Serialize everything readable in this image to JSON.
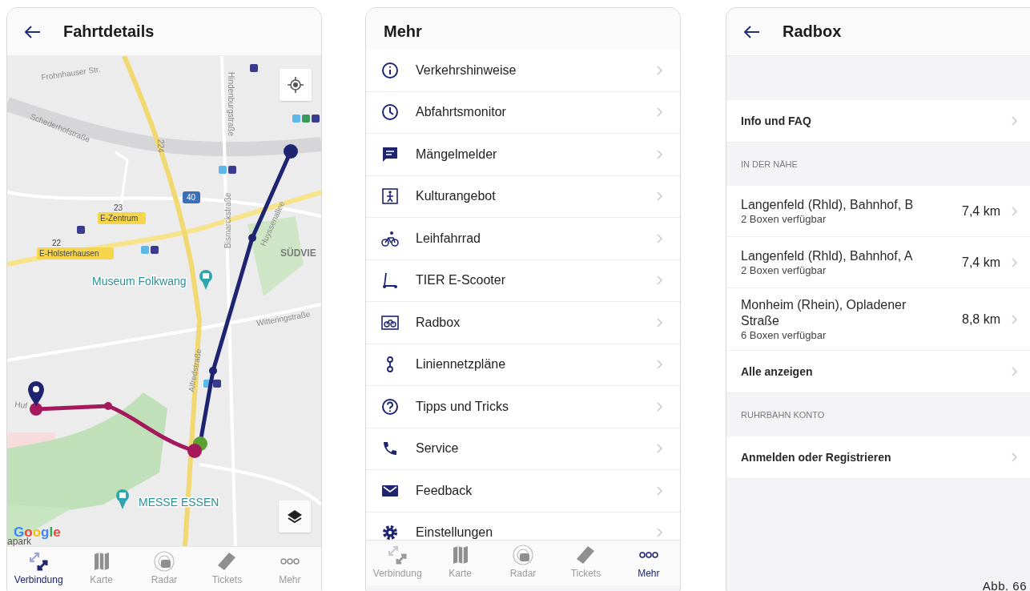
{
  "trip_details": {
    "title": "Fahrtdetails",
    "map": {
      "labels": [
        {
          "text": "Frohnhauser Str.",
          "kind": "street"
        },
        {
          "text": "Schederhofstraße",
          "kind": "street"
        },
        {
          "text": "224",
          "kind": "street"
        },
        {
          "text": "40",
          "kind": "road_number"
        },
        {
          "text": "Hindenburgstraße",
          "kind": "street"
        },
        {
          "text": "Bismarckstraße",
          "kind": "street"
        },
        {
          "text": "Huyssenallee",
          "kind": "street"
        },
        {
          "text": "23",
          "kind": "stop_number"
        },
        {
          "text": "E-Zentrum",
          "kind": "stop_label"
        },
        {
          "text": "22",
          "kind": "stop_number"
        },
        {
          "text": "E-Holsterhausen",
          "kind": "stop_label"
        },
        {
          "text": "SÜDVIE",
          "kind": "district"
        },
        {
          "text": "Museum Folkwang",
          "kind": "poi"
        },
        {
          "text": "Witteringstraße",
          "kind": "street"
        },
        {
          "text": "Alfredstraße",
          "kind": "street"
        },
        {
          "text": "Huf",
          "kind": "street"
        },
        {
          "text": "MESSE ESSEN",
          "kind": "poi"
        },
        {
          "text": "apark",
          "kind": "area"
        },
        {
          "text": "Google",
          "kind": "logo"
        }
      ]
    },
    "tab_bar": [
      {
        "label": "Verbindung",
        "selected": true
      },
      {
        "label": "Karte",
        "selected": false
      },
      {
        "label": "Radar",
        "selected": false
      },
      {
        "label": "Tickets",
        "selected": false
      },
      {
        "label": "Mehr",
        "selected": false
      }
    ]
  },
  "more_menu": {
    "title": "Mehr",
    "items": [
      {
        "label": "Verkehrshinweise"
      },
      {
        "label": "Abfahrtsmonitor"
      },
      {
        "label": "Mängelmelder"
      },
      {
        "label": "Kulturangebot"
      },
      {
        "label": "Leihfahrrad"
      },
      {
        "label": "TIER E-Scooter"
      },
      {
        "label": "Radbox"
      },
      {
        "label": "Liniennetzpläne"
      },
      {
        "label": "Tipps und Tricks"
      },
      {
        "label": "Service"
      },
      {
        "label": "Feedback"
      },
      {
        "label": "Einstellungen"
      }
    ],
    "tab_bar": [
      {
        "label": "Verbindung",
        "selected": false
      },
      {
        "label": "Karte",
        "selected": false
      },
      {
        "label": "Radar",
        "selected": false
      },
      {
        "label": "Tickets",
        "selected": false
      },
      {
        "label": "Mehr",
        "selected": true
      }
    ]
  },
  "radbox": {
    "title": "Radbox",
    "info_row": "Info und FAQ",
    "nearby": {
      "heading": "IN DER NÄHE",
      "stations": [
        {
          "name": "Langenfeld (Rhld), Bahnhof, B",
          "availability": "2 Boxen verfügbar",
          "distance": "7,4 km"
        },
        {
          "name": "Langenfeld (Rhld), Bahnhof, A",
          "availability": "2 Boxen verfügbar",
          "distance": "7,4 km"
        },
        {
          "name": "Monheim (Rhein), Opladener Straße",
          "availability": "6 Boxen verfügbar",
          "distance": "8,8 km"
        }
      ],
      "show_all": "Alle anzeigen"
    },
    "account": {
      "heading": "RUHRBAHN KONTO",
      "login": "Anmelden oder Registrieren"
    }
  },
  "caption": "Abb. 66"
}
